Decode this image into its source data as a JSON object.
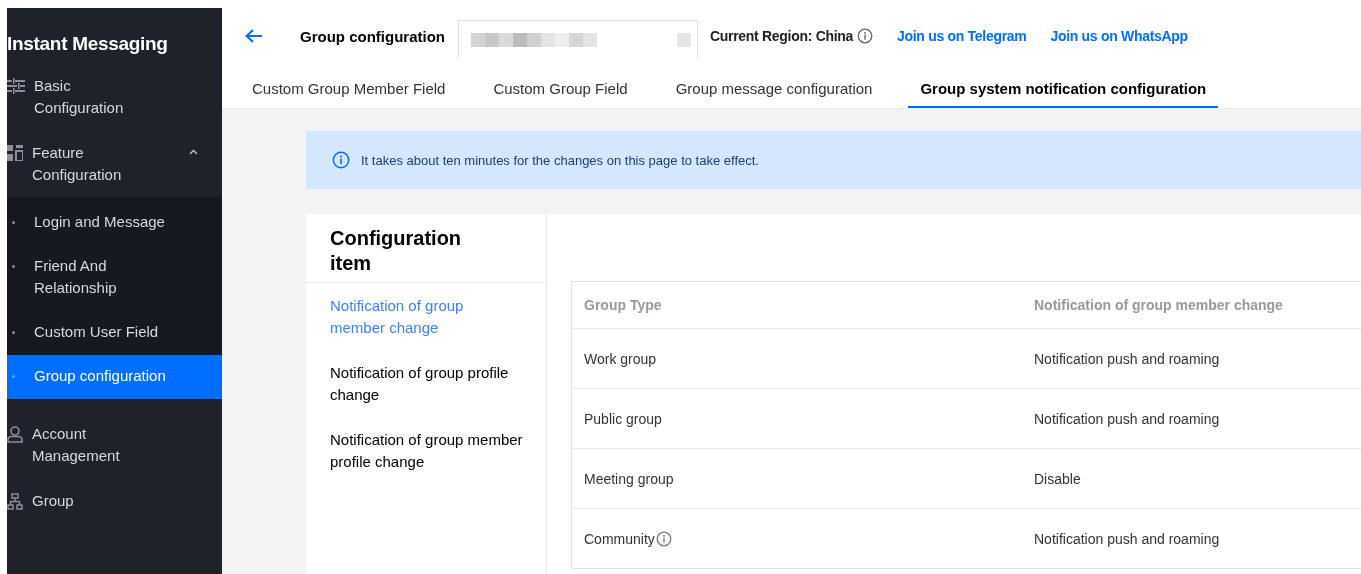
{
  "sidebar": {
    "title": "Instant Messaging",
    "items": [
      {
        "label": "Basic Configuration"
      },
      {
        "label": "Feature Configuration",
        "expanded": true,
        "children": [
          {
            "label": "Login and Message",
            "selected": false
          },
          {
            "label": "Friend And Relationship",
            "selected": false
          },
          {
            "label": "Custom User Field",
            "selected": false
          },
          {
            "label": "Group configuration",
            "selected": true
          }
        ]
      },
      {
        "label": "Account Management"
      },
      {
        "label": "Group"
      }
    ]
  },
  "header": {
    "title": "Group configuration",
    "region": "Current Region: China",
    "links": [
      "Join us on Telegram",
      "Join us on WhatsApp"
    ]
  },
  "tabs": [
    {
      "label": "Custom Group Member Field",
      "selected": false
    },
    {
      "label": "Custom Group Field",
      "selected": false
    },
    {
      "label": "Group message configuration",
      "selected": false
    },
    {
      "label": "Group system notification configuration",
      "selected": true
    }
  ],
  "notice": "It takes about ten minutes for the changes on this page to take effect.",
  "config": {
    "title": "Configuration item",
    "items": [
      {
        "label": "Notification of group member change",
        "selected": true
      },
      {
        "label": "Notification of group profile change",
        "selected": false
      },
      {
        "label": "Notification of group member profile change",
        "selected": false
      }
    ]
  },
  "table": {
    "columns": [
      "Group Type",
      "Notification of group member change"
    ],
    "rows": [
      {
        "type": "Work group",
        "value": "Notification push and roaming"
      },
      {
        "type": "Public group",
        "value": "Notification push and roaming"
      },
      {
        "type": "Meeting group",
        "value": "Disable"
      },
      {
        "type": "Community",
        "info": true,
        "value": "Notification push and roaming"
      }
    ]
  }
}
